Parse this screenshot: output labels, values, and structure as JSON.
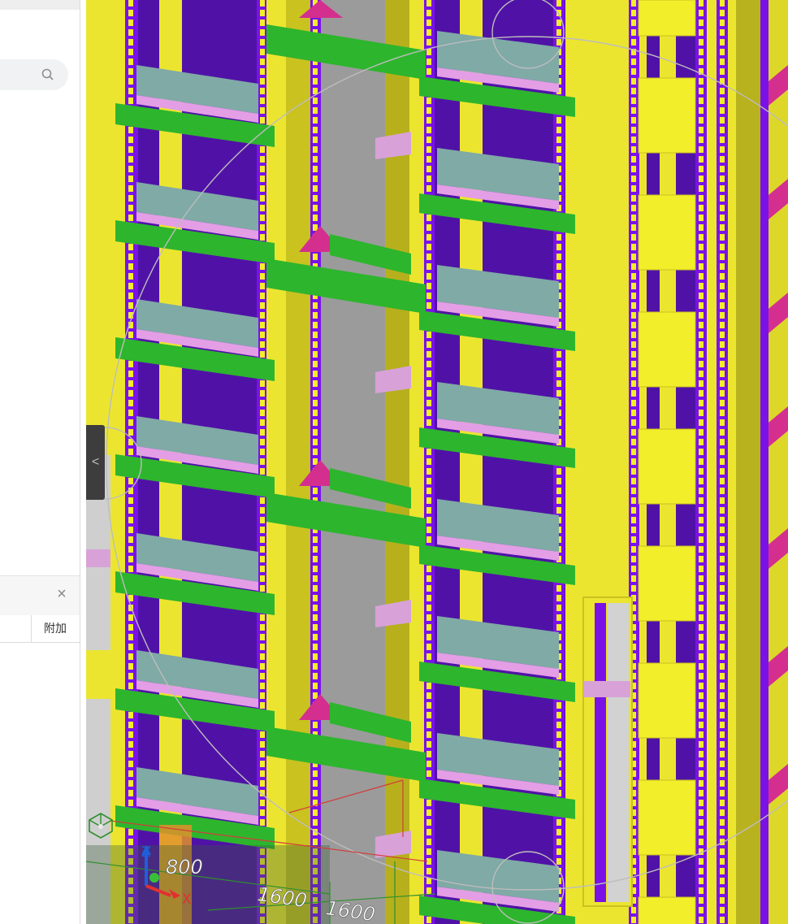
{
  "left_panel": {
    "close_symbol": "×",
    "tab_label": "附加"
  },
  "viewport": {
    "collapse_symbol": "<",
    "dimension_labels": [
      "800",
      "1600",
      "1600"
    ],
    "axis_labels": {
      "z": "Z",
      "x": "X"
    }
  },
  "icons": [
    "search-icon",
    "close-icon",
    "chevron-left-icon",
    "view-cube-icon",
    "axis-triad-icon"
  ]
}
